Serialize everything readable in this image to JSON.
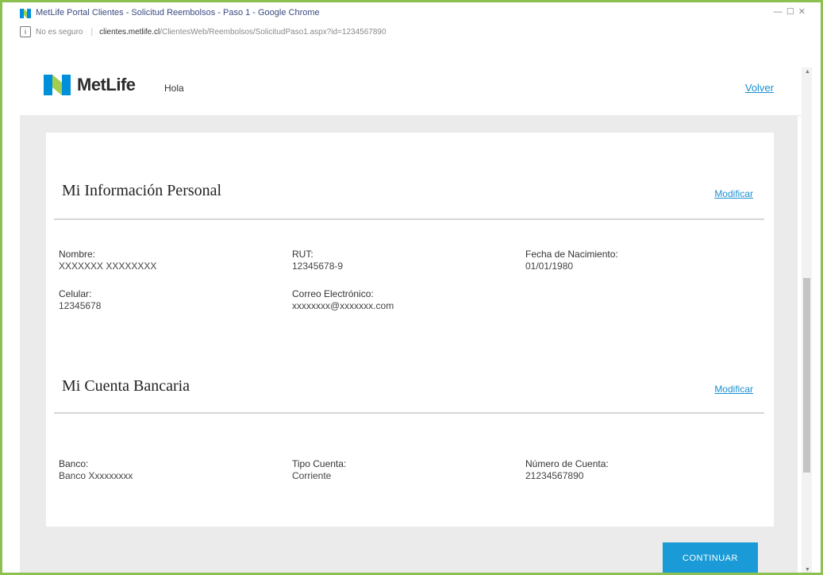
{
  "window": {
    "title": "MetLife Portal Clientes - Solicitud Reembolsos - Paso 1 - Google Chrome",
    "controls": "— ☐ ✕"
  },
  "address_bar": {
    "not_secure": "No es seguro",
    "domain": "clientes.metlife.cl",
    "path": "/ClientesWeb/Reembolsos/SolicitudPaso1.aspx?id=1234567890"
  },
  "header": {
    "brand": "MetLife",
    "greeting": "Hola",
    "back_link": "Volver"
  },
  "personal_info": {
    "title": "Mi Información Personal",
    "modify": "Modificar",
    "fields": [
      {
        "label": "Nombre:",
        "value": "XXXXXXX XXXXXXXX"
      },
      {
        "label": "RUT:",
        "value": "12345678-9"
      },
      {
        "label": "Fecha de Nacimiento:",
        "value": "01/01/1980"
      },
      {
        "label": "Celular:",
        "value": "12345678"
      },
      {
        "label": "Correo Electrónico:",
        "value": "xxxxxxxx@xxxxxxx.com"
      }
    ]
  },
  "bank_account": {
    "title": "Mi Cuenta Bancaria",
    "modify": "Modificar",
    "fields": [
      {
        "label": "Banco:",
        "value": "Banco Xxxxxxxxx"
      },
      {
        "label": "Tipo Cuenta:",
        "value": "Corriente"
      },
      {
        "label": "Número de Cuenta:",
        "value": "21234567890"
      }
    ]
  },
  "actions": {
    "continue": "CONTINUAR"
  },
  "colors": {
    "accent": "#1a9ad6",
    "link": "#1a8fd0",
    "frame_border": "#8cc152",
    "logo_blue": "#0090da",
    "logo_green": "#a4ce4e"
  }
}
